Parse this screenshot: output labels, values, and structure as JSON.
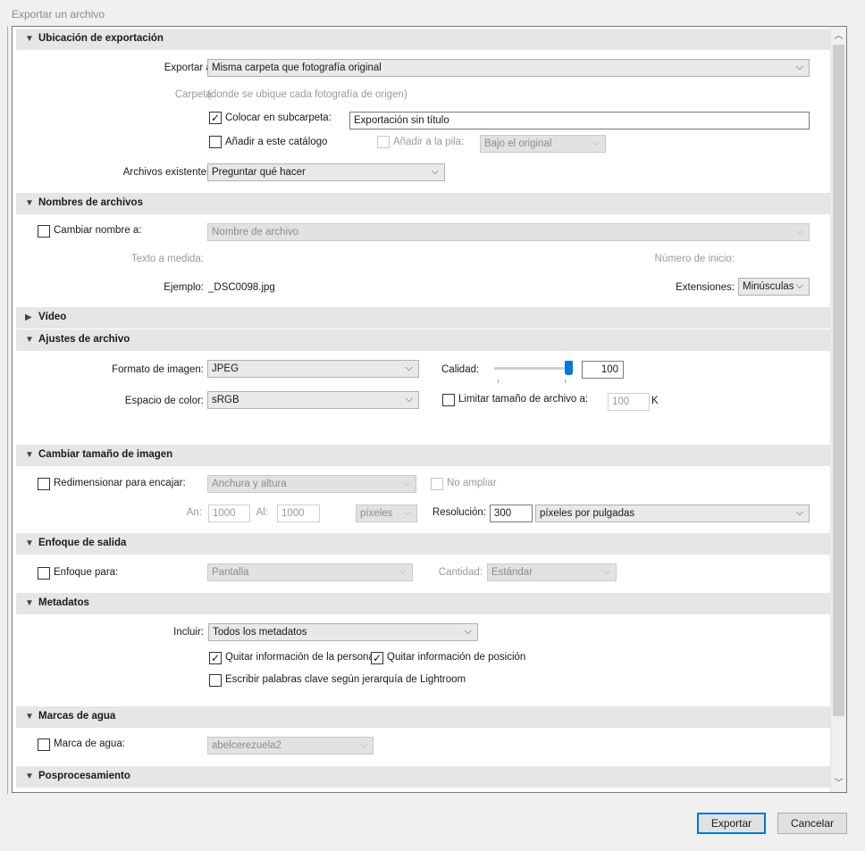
{
  "dialog_title": "Exportar un archivo",
  "sections": {
    "export_location": {
      "title": "Ubicación de exportación",
      "export_to_label": "Exportar a:",
      "export_to_value": "Misma carpeta que fotografía original",
      "folder_label": "Carpeta:",
      "folder_value": "(donde se ubique cada fotografía de origen)",
      "subfolder_label": "Colocar en subcarpeta:",
      "subfolder_value": "Exportación sin título",
      "add_catalog_label": "Añadir a este catálogo",
      "add_stack_label": "Añadir a la pila:",
      "stack_value": "Bajo el original",
      "existing_label": "Archivos existentes:",
      "existing_value": "Preguntar qué hacer"
    },
    "file_naming": {
      "title": "Nombres de archivos",
      "rename_label": "Cambiar nombre a:",
      "rename_value": "Nombre de archivo",
      "custom_text_label": "Texto a medida:",
      "start_number_label": "Número de inicio:",
      "example_label": "Ejemplo:",
      "example_value": "_DSC0098.jpg",
      "extensions_label": "Extensiones:",
      "extensions_value": "Minúsculas"
    },
    "video": {
      "title": "Vídeo"
    },
    "file_settings": {
      "title": "Ajustes de archivo",
      "format_label": "Formato de imagen:",
      "format_value": "JPEG",
      "quality_label": "Calidad:",
      "quality_value": "100",
      "colorspace_label": "Espacio de color:",
      "colorspace_value": "sRGB",
      "limit_size_label": "Limitar tamaño de archivo a:",
      "limit_size_value": "100",
      "limit_size_unit": "K"
    },
    "resize": {
      "title": "Cambiar tamaño de imagen",
      "resize_label": "Redimensionar para encajar:",
      "resize_value": "Anchura y altura",
      "no_enlarge_label": "No ampliar",
      "width_label": "An:",
      "width_value": "1000",
      "height_label": "Al:",
      "height_value": "1000",
      "units_value": "píxeles",
      "resolution_label": "Resolución:",
      "resolution_value": "300",
      "resolution_units": "píxeles por pulgadas"
    },
    "sharpening": {
      "title": "Enfoque de salida",
      "sharpen_label": "Enfoque para:",
      "sharpen_value": "Pantalla",
      "amount_label": "Cantidad:",
      "amount_value": "Estándar"
    },
    "metadata": {
      "title": "Metadatos",
      "include_label": "Incluir:",
      "include_value": "Todos los metadatos",
      "remove_person_label": "Quitar información de la persona",
      "remove_location_label": "Quitar información de posición",
      "keywords_label": "Escribir palabras clave según jerarquía de Lightroom"
    },
    "watermark": {
      "title": "Marcas de agua",
      "watermark_label": "Marca de agua:",
      "watermark_value": "abelcerezuela2"
    },
    "postprocessing": {
      "title": "Posprocesamiento"
    }
  },
  "checks": {
    "subfolder": true,
    "add_catalog": false,
    "add_stack": false,
    "rename": false,
    "limit_size": false,
    "resize": false,
    "no_enlarge": false,
    "sharpen": false,
    "remove_person": true,
    "remove_location": true,
    "keywords": false,
    "watermark": false
  },
  "quality_slider_percent": 100,
  "buttons": {
    "export": "Exportar",
    "cancel": "Cancelar"
  },
  "icons": {
    "collapse": "triangle-down-icon",
    "expand": "triangle-right-icon",
    "dropdown": "chevron-down-icon",
    "check": "checkmark-icon"
  }
}
